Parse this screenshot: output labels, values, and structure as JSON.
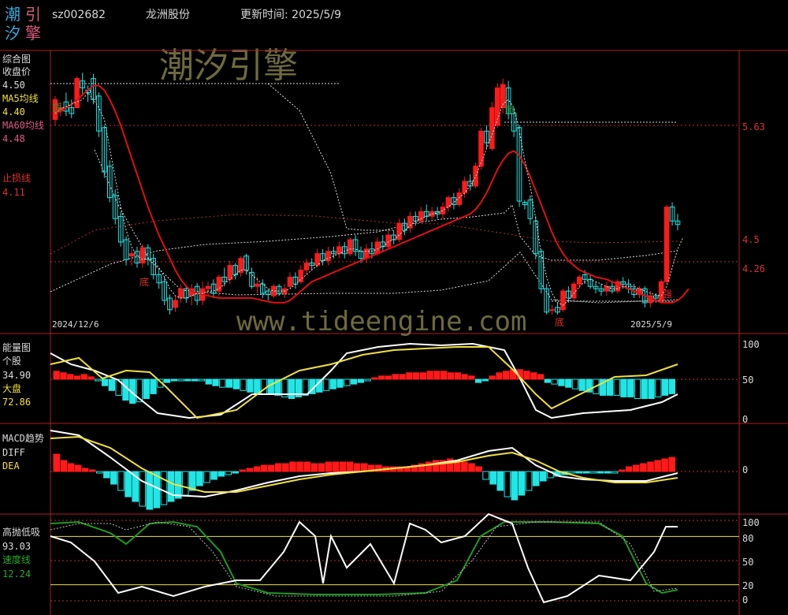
{
  "header": {
    "logo_chars": [
      "潮",
      "引",
      "汐",
      "擎"
    ],
    "stock_code": "sz002682",
    "stock_name": "龙洲股份",
    "update_time": "更新时间: 2025/5/9"
  },
  "watermarks": {
    "cn": "潮汐引擎",
    "url": "www.tideengine.com"
  },
  "colors": {
    "up": "#ff1a1a",
    "down": "#22e5e5",
    "ma5": "#ffffff",
    "ma60": "#e01010",
    "yellow": "#f0e040",
    "green": "#1f9a1f",
    "axis": "#b02020"
  },
  "panels": {
    "main": {
      "title": "综合图",
      "close_label": "收盘价",
      "close_value": "4.50",
      "ma5_label": "MA5均线",
      "ma5_value": "4.40",
      "ma60_label": "MA60均线",
      "ma60_value": "4.48",
      "stop_label": "止损线",
      "stop_value": "4.11",
      "date_start": "2024/12/6",
      "date_end": "2025/5/9",
      "marks": {
        "top1": "顶",
        "top2": "顶",
        "bottom1": "底",
        "bottom2": "底",
        "strong": "强"
      },
      "price_labels": [
        "5.63",
        "4.5",
        "4.26"
      ]
    },
    "energy": {
      "title": "能量图",
      "stock_label": "个股",
      "stock_value": "34.90",
      "market_label": "大盘",
      "market_value": "72.86",
      "axis_labels": [
        "100",
        "50",
        "0"
      ]
    },
    "macd": {
      "title": "MACD趋势",
      "diff_label": "DIFF",
      "dea_label": "DEA",
      "axis_labels": [
        "0"
      ]
    },
    "kdj": {
      "title": "高抛低吸",
      "value": "93.03",
      "speed_label": "速度线",
      "speed_value": "12.24",
      "axis_labels": [
        "100",
        "80",
        "50",
        "20",
        "0"
      ]
    }
  },
  "chart_data": [
    {
      "type": "candlestick",
      "name": "综合图",
      "ylim": [
        3.65,
        6.0
      ],
      "candles": [
        [
          5.45,
          5.62,
          5.4,
          5.65
        ],
        [
          5.52,
          5.55,
          5.48,
          5.6
        ],
        [
          5.6,
          5.52,
          5.48,
          5.68
        ],
        [
          5.55,
          5.5,
          5.46,
          5.62
        ],
        [
          5.55,
          5.8,
          5.55,
          5.82
        ],
        [
          5.78,
          5.72,
          5.65,
          5.85
        ],
        [
          5.7,
          5.68,
          5.6,
          5.74
        ],
        [
          5.8,
          5.62,
          5.58,
          5.84
        ],
        [
          5.65,
          5.35,
          5.3,
          5.68
        ],
        [
          5.38,
          5.0,
          4.95,
          5.4
        ],
        [
          5.05,
          4.78,
          4.74,
          5.1
        ],
        [
          4.8,
          4.6,
          4.55,
          4.85
        ],
        [
          4.62,
          4.4,
          4.36,
          4.66
        ],
        [
          4.42,
          4.25,
          4.2,
          4.45
        ],
        [
          4.28,
          4.3,
          4.2,
          4.34
        ],
        [
          4.32,
          4.22,
          4.18,
          4.36
        ],
        [
          4.22,
          4.35,
          4.18,
          4.38
        ],
        [
          4.35,
          4.25,
          4.2,
          4.38
        ],
        [
          4.26,
          4.12,
          4.08,
          4.3
        ],
        [
          4.12,
          4.05,
          4.0,
          4.16
        ],
        [
          4.06,
          3.9,
          3.86,
          4.1
        ],
        [
          3.92,
          3.82,
          3.78,
          3.95
        ],
        [
          3.84,
          3.9,
          3.8,
          3.94
        ],
        [
          3.92,
          4.0,
          3.88,
          4.04
        ],
        [
          4.0,
          3.92,
          3.88,
          4.02
        ],
        [
          3.94,
          4.0,
          3.86,
          4.04
        ],
        [
          4.02,
          3.9,
          3.86,
          4.05
        ],
        [
          3.9,
          4.0,
          3.86,
          4.06
        ],
        [
          4.0,
          4.02,
          3.94,
          4.06
        ],
        [
          4.04,
          3.96,
          3.92,
          4.08
        ],
        [
          3.98,
          4.1,
          3.94,
          4.12
        ],
        [
          4.1,
          4.06,
          4.02,
          4.18
        ],
        [
          4.08,
          4.2,
          4.04,
          4.24
        ],
        [
          4.2,
          4.12,
          4.08,
          4.22
        ],
        [
          4.14,
          4.26,
          4.1,
          4.28
        ],
        [
          4.28,
          4.16,
          4.12,
          4.3
        ],
        [
          4.14,
          4.02,
          4.0,
          4.18
        ],
        [
          4.02,
          4.04,
          3.96,
          4.1
        ],
        [
          4.04,
          3.96,
          3.92,
          4.08
        ],
        [
          3.98,
          3.95,
          3.9,
          4.0
        ],
        [
          3.94,
          4.02,
          3.92,
          4.04
        ],
        [
          4.02,
          3.96,
          3.94,
          4.04
        ],
        [
          3.96,
          4.0,
          3.92,
          4.04
        ],
        [
          4.02,
          4.1,
          4.0,
          4.14
        ],
        [
          4.1,
          4.04,
          4.0,
          4.14
        ],
        [
          4.06,
          4.16,
          4.04,
          4.2
        ],
        [
          4.16,
          4.22,
          4.12,
          4.26
        ],
        [
          4.22,
          4.2,
          4.16,
          4.26
        ],
        [
          4.2,
          4.3,
          4.18,
          4.34
        ],
        [
          4.3,
          4.24,
          4.2,
          4.34
        ],
        [
          4.24,
          4.32,
          4.2,
          4.36
        ],
        [
          4.32,
          4.3,
          4.26,
          4.36
        ],
        [
          4.3,
          4.36,
          4.26,
          4.4
        ],
        [
          4.36,
          4.3,
          4.26,
          4.4
        ],
        [
          4.3,
          4.42,
          4.28,
          4.44
        ],
        [
          4.42,
          4.32,
          4.28,
          4.46
        ],
        [
          4.32,
          4.26,
          4.22,
          4.36
        ],
        [
          4.26,
          4.34,
          4.22,
          4.38
        ],
        [
          4.34,
          4.3,
          4.26,
          4.4
        ],
        [
          4.3,
          4.4,
          4.28,
          4.44
        ],
        [
          4.4,
          4.36,
          4.32,
          4.46
        ],
        [
          4.36,
          4.46,
          4.34,
          4.5
        ],
        [
          4.46,
          4.42,
          4.38,
          4.5
        ],
        [
          4.42,
          4.56,
          4.4,
          4.6
        ],
        [
          4.56,
          4.5,
          4.46,
          4.6
        ],
        [
          4.52,
          4.62,
          4.48,
          4.66
        ],
        [
          4.62,
          4.58,
          4.54,
          4.66
        ],
        [
          4.58,
          4.66,
          4.56,
          4.7
        ],
        [
          4.66,
          4.62,
          4.58,
          4.72
        ],
        [
          4.62,
          4.66,
          4.58,
          4.7
        ],
        [
          4.66,
          4.64,
          4.6,
          4.7
        ],
        [
          4.64,
          4.7,
          4.6,
          4.74
        ],
        [
          4.7,
          4.78,
          4.66,
          4.8
        ],
        [
          4.78,
          4.72,
          4.68,
          4.82
        ],
        [
          4.72,
          4.82,
          4.7,
          4.86
        ],
        [
          4.82,
          4.92,
          4.78,
          4.96
        ],
        [
          4.92,
          4.88,
          4.84,
          4.98
        ],
        [
          4.88,
          5.05,
          4.86,
          5.08
        ],
        [
          5.05,
          5.35,
          5.02,
          5.38
        ],
        [
          5.35,
          5.25,
          5.2,
          5.4
        ],
        [
          5.2,
          5.55,
          5.18,
          5.6
        ],
        [
          5.4,
          5.72,
          5.38,
          5.76
        ],
        [
          5.55,
          5.75,
          5.5,
          5.8
        ],
        [
          5.72,
          5.5,
          5.45,
          5.78
        ],
        [
          5.5,
          5.35,
          5.3,
          5.55
        ],
        [
          5.38,
          4.75,
          4.7,
          5.4
        ],
        [
          4.74,
          4.72,
          4.68,
          4.76
        ],
        [
          4.76,
          4.6,
          4.55,
          4.8
        ],
        [
          4.58,
          4.3,
          4.25,
          4.62
        ],
        [
          4.32,
          4.0,
          3.96,
          4.34
        ],
        [
          4.0,
          3.8,
          3.78,
          4.04
        ],
        [
          3.82,
          3.82,
          3.78,
          3.86
        ],
        [
          3.84,
          3.8,
          3.78,
          3.88
        ],
        [
          3.82,
          3.98,
          3.8,
          4.0
        ],
        [
          3.98,
          3.92,
          3.88,
          4.02
        ],
        [
          3.92,
          4.04,
          3.9,
          4.06
        ],
        [
          4.04,
          4.1,
          4.0,
          4.12
        ],
        [
          4.12,
          4.08,
          4.04,
          4.16
        ],
        [
          4.08,
          4.02,
          4.0,
          4.12
        ],
        [
          4.02,
          4.0,
          3.96,
          4.06
        ],
        [
          4.0,
          3.98,
          3.94,
          4.04
        ],
        [
          3.98,
          4.02,
          3.94,
          4.06
        ],
        [
          4.02,
          3.98,
          3.96,
          4.06
        ],
        [
          3.98,
          4.06,
          3.96,
          4.08
        ],
        [
          4.06,
          4.04,
          4.0,
          4.1
        ],
        [
          4.04,
          4.0,
          3.96,
          4.08
        ],
        [
          4.0,
          3.95,
          3.92,
          4.04
        ],
        [
          3.95,
          4.0,
          3.92,
          4.02
        ],
        [
          4.0,
          3.88,
          3.84,
          4.02
        ],
        [
          3.88,
          3.94,
          3.84,
          3.98
        ],
        [
          3.94,
          3.92,
          3.88,
          3.96
        ],
        [
          3.9,
          4.06,
          3.88,
          4.08
        ],
        [
          4.06,
          4.7,
          4.04,
          4.72
        ],
        [
          4.7,
          4.58,
          4.54,
          4.74
        ],
        [
          4.58,
          4.55,
          4.5,
          4.64
        ]
      ],
      "ma5_close": [
        5.5,
        5.54,
        5.56,
        5.58,
        5.6,
        5.62,
        5.68,
        5.62,
        5.55,
        5.45,
        5.2,
        4.95,
        4.7,
        4.5,
        4.36,
        4.28,
        4.25,
        4.26,
        4.24,
        4.18,
        4.1,
        4.0,
        3.94,
        3.92,
        3.92,
        3.94,
        3.96,
        3.96,
        3.98,
        3.98,
        4.0,
        4.04,
        4.08,
        4.12,
        4.16,
        4.16,
        4.12,
        4.08,
        4.04,
        4.0,
        3.98,
        3.98,
        3.98,
        4.0,
        4.04,
        4.08,
        4.12,
        4.16,
        4.2,
        4.24,
        4.26,
        4.28,
        4.3,
        4.32,
        4.34,
        4.34,
        4.32,
        4.32,
        4.32,
        4.34,
        4.36,
        4.4,
        4.42,
        4.46,
        4.5,
        4.54,
        4.58,
        4.6,
        4.62,
        4.64,
        4.65,
        4.67,
        4.7,
        4.74,
        4.78,
        4.82,
        4.88,
        4.96,
        5.08,
        5.2,
        5.32,
        5.45,
        5.58,
        5.62,
        5.55,
        5.35,
        5.1,
        4.88,
        4.6,
        4.3,
        4.1,
        3.96,
        3.88,
        3.86,
        3.9,
        3.96,
        4.02,
        4.06,
        4.08,
        4.06,
        4.04,
        4.02,
        4.0,
        4.0,
        4.02,
        4.02,
        4.02,
        4.0,
        3.98,
        3.96,
        3.95,
        3.94,
        4.02,
        4.18,
        4.34,
        4.44
      ],
      "ma60_series": [
        5.5,
        5.52,
        5.55,
        5.58,
        5.62,
        5.66,
        5.7,
        5.74,
        5.74,
        5.7,
        5.62,
        5.52,
        5.4,
        5.26,
        5.12,
        4.98,
        4.84,
        4.7,
        4.58,
        4.46,
        4.36,
        4.26,
        4.16,
        4.08,
        4.02,
        3.98,
        3.96,
        3.95,
        3.94,
        3.93,
        3.92,
        3.92,
        3.92,
        3.92,
        3.92,
        3.92,
        3.92,
        3.91,
        3.9,
        3.89,
        3.88,
        3.88,
        3.88,
        3.9,
        3.94,
        3.98,
        4.02,
        4.06,
        4.08,
        4.1,
        4.12,
        4.14,
        4.16,
        4.18,
        4.2,
        4.22,
        4.24,
        4.26,
        4.28,
        4.3,
        4.32,
        4.34,
        4.36,
        4.38,
        4.4,
        4.42,
        4.44,
        4.46,
        4.48,
        4.5,
        4.52,
        4.54,
        4.56,
        4.58,
        4.6,
        4.62,
        4.64,
        4.68,
        4.74,
        4.82,
        4.92,
        5.02,
        5.1,
        5.16,
        5.18,
        5.14,
        5.06,
        4.96,
        4.84,
        4.72,
        4.6,
        4.48,
        4.38,
        4.3,
        4.24,
        4.2,
        4.16,
        4.14,
        4.12,
        4.1,
        4.09,
        4.08,
        4.06,
        4.04,
        4.02,
        4.0,
        3.98,
        3.96,
        3.94,
        3.92,
        3.9,
        3.88,
        3.88,
        3.88,
        3.9,
        3.94,
        4.0
      ]
    }
  ]
}
